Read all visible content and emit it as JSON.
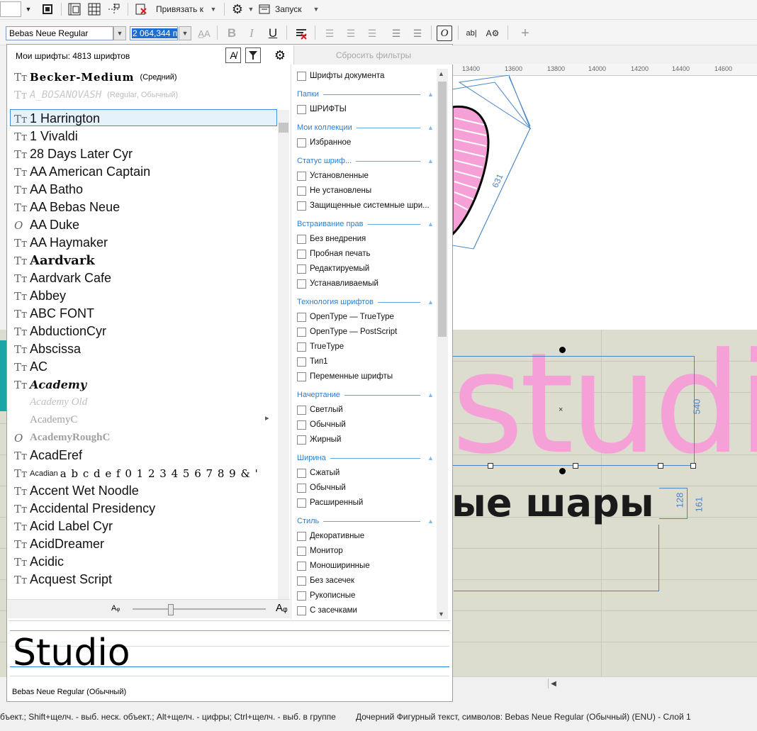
{
  "toolbar_top": {
    "snap_label": "Привязать к",
    "launch_label": "Запуск"
  },
  "toolbar_props": {
    "font_name": "Bebas Neue Regular",
    "font_size": "2 064,344 п"
  },
  "font_panel": {
    "header": "Мои шрифты: 4813 шрифтов",
    "reset_filters": "Сбросить фильтры",
    "recent_fonts": [
      {
        "name": "Becker-Medium",
        "style": "(Средний)"
      },
      {
        "name": "A_BOSANOVASH",
        "style": "(Regular, Обычный)"
      }
    ],
    "fonts": [
      "1 Harrington",
      "1 Vivaldi",
      "28 Days Later Cyr",
      "AA American Captain",
      "AA Batho",
      "AA Bebas Neue",
      "AA Duke",
      "AA Haymaker",
      "Aardvark",
      "Aardvark Cafe",
      "Abbey",
      "ABC FONT",
      "AbductionCyr",
      "Abscissa",
      "AC",
      "Academy",
      "Academy Old",
      "AcademyC",
      "AcademyRoughC",
      "AcadEref",
      "Acadian",
      "Accent Wet Noodle",
      "Accidental Presidency",
      "Acid Label Cyr",
      "AcidDreamer",
      "Acidic",
      "Acquest Script"
    ],
    "acadian_sample": "a b c d e f 0 1 2 3 4 5 6 7 8 9 & '",
    "preview_text": "Studio",
    "preview_font": "Bebas Neue Regular (Обычный)",
    "filters": {
      "doc_fonts": "Шрифты документа",
      "folders": {
        "title": "Папки",
        "items": [
          "ШРИФТЫ"
        ]
      },
      "collections": {
        "title": "Мои коллекции",
        "items": [
          "Избранное"
        ]
      },
      "status": {
        "title": "Статус шриф...",
        "items": [
          "Установленные",
          "Не установлены",
          "Защищенные системные шри..."
        ]
      },
      "embedding": {
        "title": "Встраивание прав",
        "items": [
          "Без внедрения",
          "Пробная печать",
          "Редактируемый",
          "Устанавливаемый"
        ]
      },
      "tech": {
        "title": "Технология шрифтов",
        "items": [
          "OpenType — TrueType",
          "OpenType — PostScript",
          "TrueType",
          "Тип1",
          "Переменные шрифты"
        ]
      },
      "weight": {
        "title": "Начертание",
        "items": [
          "Светлый",
          "Обычный",
          "Жирный"
        ]
      },
      "width": {
        "title": "Ширина",
        "items": [
          "Сжатый",
          "Обычный",
          "Расширенный"
        ]
      },
      "style": {
        "title": "Стиль",
        "items": [
          "Декоративные",
          "Монитор",
          "Моноширинные",
          "Без засечек",
          "Рукописные",
          "С засечками"
        ]
      }
    }
  },
  "canvas": {
    "ruler_marks": [
      "13400",
      "13600",
      "13800",
      "14000",
      "14200",
      "14400",
      "14600"
    ],
    "studio_text": "studio",
    "balloons_text": "ые шары",
    "dims": [
      "631",
      "540",
      "128",
      "161"
    ]
  },
  "status_bar": {
    "left": "бъект.; Shift+щелч. - выб. неск. объект.; Alt+щелч. - цифры; Ctrl+щелч. - выб. в группе",
    "right": "Дочерний Фигурный текст, символов: Bebas Neue Regular (Обычный) (ENU) - Слой 1"
  },
  "colors": {
    "pink": "#f5a0d6",
    "accent": "#2e7ed0",
    "canvas_bg": "#dcdccf"
  }
}
